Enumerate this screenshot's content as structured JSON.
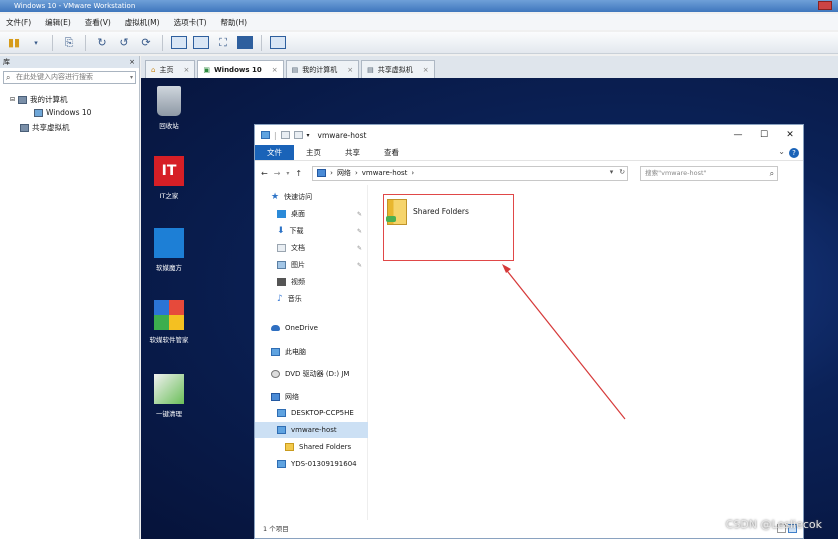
{
  "vm": {
    "title": "Windows 10 - VMware Workstation",
    "menu": [
      "文件(F)",
      "编辑(E)",
      "查看(V)",
      "虚拟机(M)",
      "选项卡(T)",
      "帮助(H)"
    ],
    "library": {
      "header": "库",
      "close": "×",
      "search_placeholder": "在此处键入内容进行搜索",
      "tree": [
        {
          "label": "我的计算机"
        },
        {
          "label": "Windows 10"
        },
        {
          "label": "共享虚拟机"
        }
      ]
    },
    "tabs": [
      {
        "label": "主页"
      },
      {
        "label": "Windows 10"
      },
      {
        "label": "我的计算机"
      },
      {
        "label": "共享虚拟机"
      }
    ]
  },
  "desktop": {
    "icons": [
      {
        "label": "回收站"
      },
      {
        "label": "IT之家"
      },
      {
        "label": "软媒魔方"
      },
      {
        "label": "软媒软件管家"
      },
      {
        "label": "一键清理"
      }
    ],
    "it_logo_text": "IT"
  },
  "explorer": {
    "title": "vmware-host",
    "ribbon_tabs": [
      "文件",
      "主页",
      "共享",
      "查看"
    ],
    "address": {
      "segments": [
        "网络",
        "vmware-host"
      ]
    },
    "search_placeholder": "搜索\"vmware-host\"",
    "nav": [
      {
        "label": "快速访问",
        "icon": "star-icon"
      },
      {
        "label": "桌面",
        "icon": "desktop-icon",
        "pinned": true
      },
      {
        "label": "下载",
        "icon": "download-icon",
        "pinned": true
      },
      {
        "label": "文档",
        "icon": "document-icon",
        "pinned": true
      },
      {
        "label": "图片",
        "icon": "picture-icon",
        "pinned": true
      },
      {
        "label": "视频",
        "icon": "video-icon"
      },
      {
        "label": "音乐",
        "icon": "music-icon"
      },
      {
        "label": "OneDrive",
        "icon": "onedrive-icon"
      },
      {
        "label": "此电脑",
        "icon": "computer-icon"
      },
      {
        "label": "DVD 驱动器 (D:) JM",
        "icon": "dvd-icon"
      },
      {
        "label": "网络",
        "icon": "network-icon"
      },
      {
        "label": "DESKTOP-CCP5HE",
        "icon": "computer-icon"
      },
      {
        "label": "vmware-host",
        "icon": "computer-icon",
        "selected": true
      },
      {
        "label": "Shared Folders",
        "icon": "folder-icon"
      },
      {
        "label": "YDS-01309191604",
        "icon": "computer-icon"
      }
    ],
    "items": [
      {
        "label": "Shared Folders"
      }
    ],
    "status": "1 个项目"
  },
  "watermark": "CSDN @Lesliecok"
}
